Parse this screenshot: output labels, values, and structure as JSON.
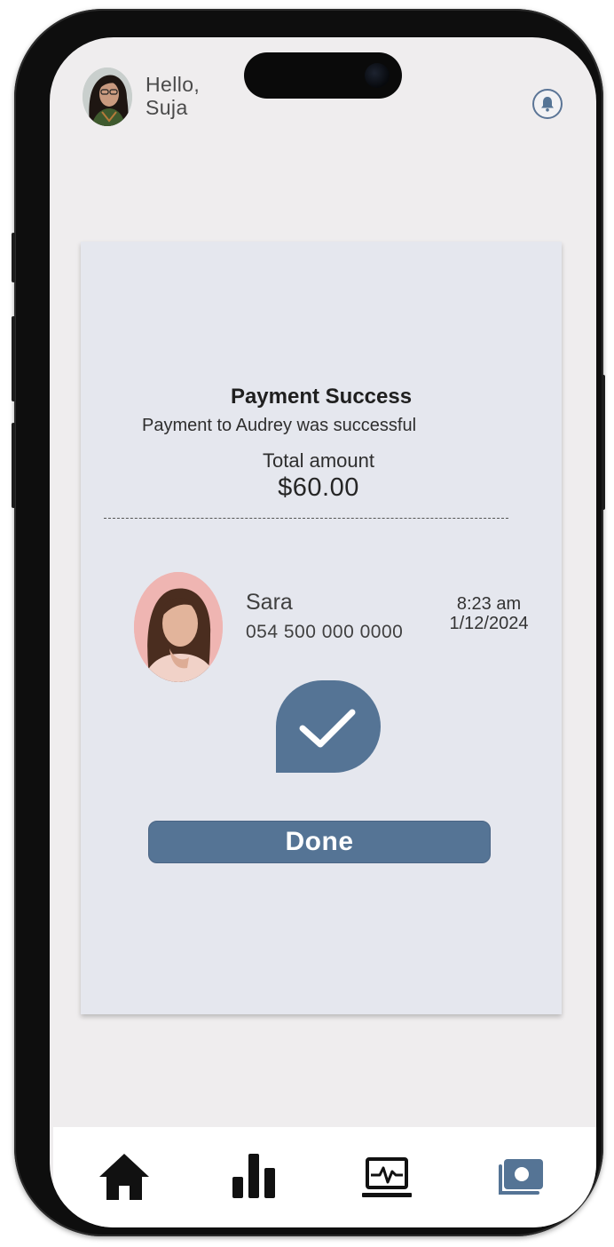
{
  "header": {
    "greeting": "Hello,",
    "user_name": "Suja"
  },
  "payment": {
    "title": "Payment Success",
    "message": "Payment to Audrey was successful",
    "total_label": "Total amount",
    "total_value": "$60.00"
  },
  "payee": {
    "name": "Sara",
    "phone": "054 500 000 0000",
    "time": "8:23 am",
    "date": "1/12/2024"
  },
  "actions": {
    "done_label": "Done"
  },
  "tabs": [
    {
      "icon": "home-icon",
      "active": false
    },
    {
      "icon": "bar-chart-icon",
      "active": false
    },
    {
      "icon": "activity-monitor-icon",
      "active": false
    },
    {
      "icon": "wallet-icon",
      "active": true
    }
  ],
  "colors": {
    "accent": "#557495",
    "card_bg": "#e5e7ee",
    "screen_bg": "#efedee",
    "tab_inactive": "#111111",
    "tab_active": "#557495"
  }
}
